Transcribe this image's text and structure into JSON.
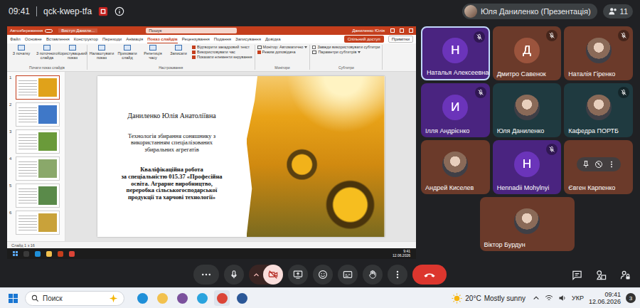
{
  "meeting": {
    "time": "09:41",
    "code": "qck-kwep-tfa",
    "presenter": "Юля Даниленко (Презентація)",
    "participant_count": "11"
  },
  "powerpoint": {
    "autosave": "Автозбереження",
    "doc_title": "Виступ Даниле...",
    "search": "Пошук",
    "user": "Даниленко Юлія",
    "share": "Спільний доступ",
    "notes": "Примітки",
    "tabs": [
      {
        "label": "Файл",
        "selected": false
      },
      {
        "label": "Основне",
        "selected": false
      },
      {
        "label": "Вставлення",
        "selected": false
      },
      {
        "label": "Конструктор",
        "selected": false
      },
      {
        "label": "Переходи",
        "selected": false
      },
      {
        "label": "Анімація",
        "selected": false
      },
      {
        "label": "Показ слайдів",
        "selected": true
      },
      {
        "label": "Рецензування",
        "selected": false
      },
      {
        "label": "Подання",
        "selected": false
      },
      {
        "label": "Записування",
        "selected": false
      },
      {
        "label": "Довідка",
        "selected": false
      }
    ],
    "ribbon_groups": [
      {
        "label": "Почати показ слайдів",
        "items": [
          {
            "kind": "button",
            "label": "З початку",
            "checked": false
          },
          {
            "kind": "button",
            "label": "З поточного слайда",
            "checked": false
          },
          {
            "kind": "button",
            "label": "Користувацький показ",
            "checked": false
          }
        ]
      },
      {
        "label": "Настроювання",
        "items": [
          {
            "kind": "button",
            "label": "Налаштувати показ",
            "checked": false
          },
          {
            "kind": "button",
            "label": "Приховати слайд",
            "checked": false
          },
          {
            "kind": "button",
            "label": "Репетиція часу",
            "checked": false
          },
          {
            "kind": "button",
            "label": "Записати",
            "checked": false
          },
          {
            "kind": "check",
            "label": "Відтворити закадровий текст",
            "checked": true
          },
          {
            "kind": "check",
            "label": "Використовувати час",
            "checked": true
          },
          {
            "kind": "check",
            "label": "Показати елементи керування",
            "checked": true
          }
        ]
      },
      {
        "label": "Монітори",
        "items": [
          {
            "kind": "dropdown",
            "label": "Монітор: Автоматично",
            "checked": false
          },
          {
            "kind": "check",
            "label": "Режим доповідача",
            "checked": true
          }
        ]
      },
      {
        "label": "Субтитри",
        "items": [
          {
            "kind": "check",
            "label": "Завжди використовувати субтитри",
            "checked": false
          },
          {
            "kind": "dropdown",
            "label": "Параметри субтитрів",
            "checked": false
          }
        ]
      }
    ],
    "thumbnails": [
      {
        "number": "1",
        "selected": true,
        "color": "#e0a21a"
      },
      {
        "number": "2",
        "selected": false,
        "color": "#3f78c8"
      },
      {
        "number": "3",
        "selected": false,
        "color": "#6a9a3a"
      },
      {
        "number": "4",
        "selected": false,
        "color": "#8aa86a"
      },
      {
        "number": "5",
        "selected": false,
        "color": "#5a8a4a"
      },
      {
        "number": "6",
        "selected": false,
        "color": "#c9a23a"
      }
    ],
    "slide": {
      "author": "Даниленко Юлія Анатоліївна",
      "title_lines": [
        "Технологія збирання соняшнику з",
        "використанням спеціалізованих",
        "збиральних агрегатів"
      ],
      "subtitle_lines": [
        "Кваліфікаційна робота",
        "за спеціальністю 015.37 «Професійна",
        "освіта. Аграрне виробництво,",
        "переробка сільськогосподарської",
        "продукції та харчові технології»"
      ]
    },
    "status": "Слайд 1 з 16"
  },
  "inner_taskbar": {
    "time": "9:41",
    "date": "12.06.2026"
  },
  "participants": [
    {
      "name": "Наталья Алексеевна",
      "kind": "letter",
      "initial": "Н",
      "color": "#4a2480",
      "muted": true,
      "speaking": true,
      "hovered": false
    },
    {
      "name": "Дмитро Савенок",
      "kind": "letter",
      "initial": "Д",
      "color": "#6b3a2a",
      "muted": true,
      "speaking": false,
      "hovered": false
    },
    {
      "name": "Наталія Гіренко",
      "kind": "photo",
      "initial": "",
      "color": "#6b3a2a",
      "muted": true,
      "speaking": false,
      "hovered": false
    },
    {
      "name": "Ілля Андрієнко",
      "kind": "letter",
      "initial": "И",
      "color": "#4a2480",
      "muted": true,
      "speaking": false,
      "hovered": false
    },
    {
      "name": "Юля Даниленко",
      "kind": "photo",
      "initial": "",
      "color": "#1f3a40",
      "muted": false,
      "speaking": false,
      "hovered": false
    },
    {
      "name": "Кафедра ПОРТБ",
      "kind": "photo",
      "initial": "",
      "color": "#1f3a40",
      "muted": true,
      "speaking": false,
      "hovered": false
    },
    {
      "name": "Андрей Киселев",
      "kind": "photo",
      "initial": "",
      "color": "#6b3a2a",
      "muted": false,
      "speaking": false,
      "hovered": false
    },
    {
      "name": "Hennadii Mohylnyi",
      "kind": "letter",
      "initial": "H",
      "color": "#4a2480",
      "muted": true,
      "speaking": false,
      "hovered": false
    },
    {
      "name": "Євген Карпенко",
      "kind": "letter",
      "initial": "",
      "color": "#6b3a2a",
      "muted": false,
      "speaking": false,
      "hovered": true
    },
    {
      "name": "Віктор Бурдун",
      "kind": "photo",
      "initial": "",
      "color": "#6b3a2a",
      "muted": false,
      "speaking": false,
      "hovered": false
    }
  ],
  "controls": [
    {
      "kind": "more",
      "on": true
    },
    {
      "kind": "mic",
      "on": true
    },
    {
      "kind": "camera",
      "on": false
    },
    {
      "kind": "present",
      "on": true
    },
    {
      "kind": "emoji",
      "on": true
    },
    {
      "kind": "captions",
      "on": true
    },
    {
      "kind": "hand",
      "on": true
    },
    {
      "kind": "options",
      "on": true
    },
    {
      "kind": "hangup",
      "on": true
    }
  ],
  "side_controls": [
    {
      "kind": "chat"
    },
    {
      "kind": "activities"
    },
    {
      "kind": "host"
    }
  ],
  "taskbar": {
    "search": "Поиск",
    "apps": [
      {
        "kind": "edge",
        "color": "#1f8fd8",
        "active": false
      },
      {
        "kind": "explorer",
        "color": "#f2c14e",
        "active": false
      },
      {
        "kind": "viber",
        "color": "#7b519d",
        "active": false
      },
      {
        "kind": "telegram",
        "color": "#2aa3de",
        "active": false
      },
      {
        "kind": "chrome",
        "color": "#db4437",
        "active": true
      },
      {
        "kind": "word",
        "color": "#2b5797",
        "active": false
      }
    ],
    "temperature": "20°C",
    "weather": "Mostly sunny",
    "language": "УКР",
    "time": "09:41",
    "date": "12.06.2026",
    "notifications": "3"
  }
}
